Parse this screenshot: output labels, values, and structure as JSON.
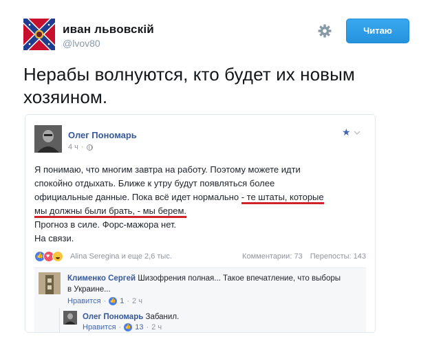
{
  "tweet": {
    "author_name": "иван львовскiй",
    "handle": "@lvov80",
    "follow_label": "Читаю",
    "text": "Нерабы волнуются, кто будет их новым хозяином.",
    "icons": {
      "settings": "gear-icon",
      "avatar": "confederate-flag-avatar"
    },
    "colors": {
      "accent": "#1da1f2",
      "handle": "#8899a6"
    }
  },
  "fb_post": {
    "author_name": "Олег Пономарь",
    "time": "4 ч",
    "body_lines": {
      "l1": "Я понимаю, что многим завтра на работу. Поэтому можете идти",
      "l2": "спокойно отдыхать. Ближе к утру будут появляться более",
      "l3a": "официальные данные. Пока всё идет нормально ",
      "l3b": "- те штаты, которые",
      "l4a": "мы должны были брать, - мы берем.",
      "l5": "Прогноз в силе. Форс-мажора нет.",
      "l6": "На связи."
    },
    "reactions_text": "Alina Seregina и еще 2,6 тыс.",
    "comments_count": "Комментарии: 73",
    "shares_count": "Перепосты: 143",
    "colors": {
      "link": "#365899",
      "highlight_underline": "#d0222a"
    }
  },
  "comments": [
    {
      "author": "Клименко Сергей",
      "text_l1": "Шизофрения полная... Такое впечатление, что выборы",
      "text_l2": "в Украине...",
      "like_label": "Нравится",
      "likes": "1",
      "time": "2 ч"
    },
    {
      "author": "Олег Пономарь",
      "text_l1": "Забанил.",
      "like_label": "Нравится",
      "likes": "13",
      "time": "2 ч"
    }
  ]
}
